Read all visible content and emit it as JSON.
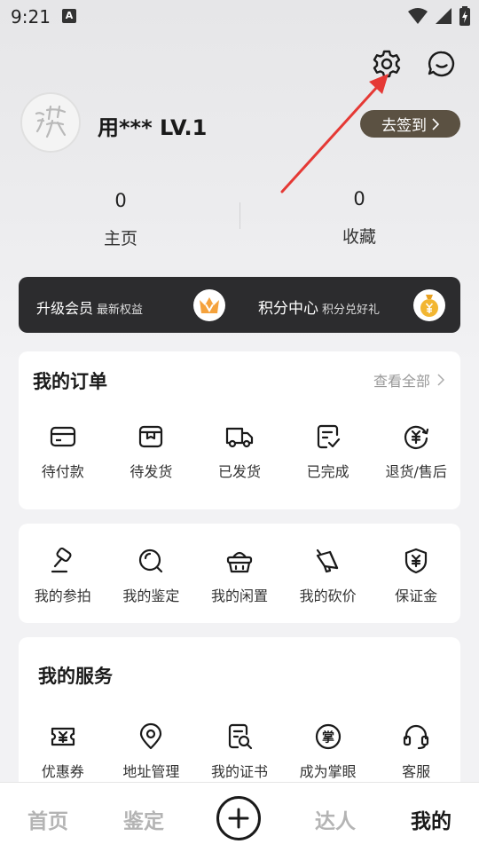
{
  "status_bar": {
    "time": "9:21",
    "notification_letter": "A"
  },
  "header": {
    "settings_icon": "gear-icon",
    "message_icon": "chat-bubble-icon"
  },
  "profile": {
    "username": "用*** LV.1",
    "signin_label": "去签到"
  },
  "stats": [
    {
      "value": "0",
      "label": "主页"
    },
    {
      "value": "0",
      "label": "收藏"
    }
  ],
  "banner": {
    "upgrade_title": "升级会员",
    "upgrade_sub": "最新权益",
    "points_title": "积分中心",
    "points_sub": "积分兑好礼"
  },
  "orders": {
    "title": "我的订单",
    "view_all": "查看全部",
    "items": [
      {
        "label": "待付款",
        "icon": "card-icon"
      },
      {
        "label": "待发货",
        "icon": "box-icon"
      },
      {
        "label": "已发货",
        "icon": "truck-icon"
      },
      {
        "label": "已完成",
        "icon": "check-doc-icon"
      },
      {
        "label": "退货/售后",
        "icon": "refund-icon"
      }
    ]
  },
  "activity": {
    "items": [
      {
        "label": "我的参拍",
        "icon": "gavel-icon"
      },
      {
        "label": "我的鉴定",
        "icon": "magnifier-icon"
      },
      {
        "label": "我的闲置",
        "icon": "basket-icon"
      },
      {
        "label": "我的砍价",
        "icon": "megaphone-icon"
      },
      {
        "label": "保证金",
        "icon": "shield-yen-icon"
      }
    ]
  },
  "services": {
    "title": "我的服务",
    "items": [
      {
        "label": "优惠券",
        "icon": "coupon-icon"
      },
      {
        "label": "地址管理",
        "icon": "location-icon"
      },
      {
        "label": "我的证书",
        "icon": "certificate-icon"
      },
      {
        "label": "成为掌眼",
        "icon": "badge-zhang-icon"
      },
      {
        "label": "客服",
        "icon": "headset-icon"
      }
    ]
  },
  "bottom_nav": {
    "home": "首页",
    "appraise": "鉴定",
    "experts": "达人",
    "mine": "我的"
  },
  "colors": {
    "accent_dark": "#2c2c2e",
    "signin_bg": "#5b5142",
    "annotation_red": "#e53935",
    "vip_orange": "#f5a23c",
    "coin_gold": "#f2b632"
  }
}
